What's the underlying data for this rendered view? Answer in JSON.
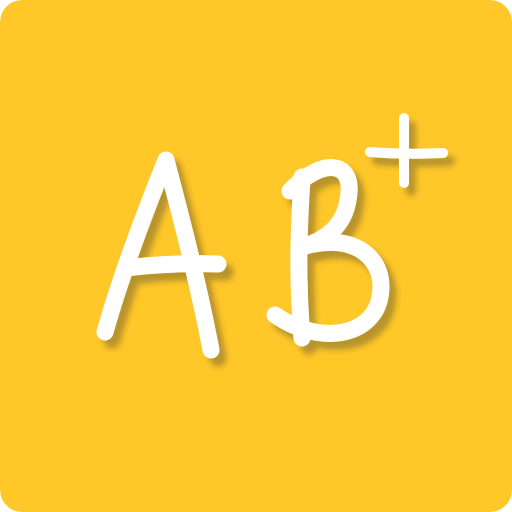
{
  "icon": {
    "logo_text": "AB+",
    "background_color": "#FFC728",
    "glyph_color": "#FFFFFF",
    "shadow_color": "#333333"
  }
}
